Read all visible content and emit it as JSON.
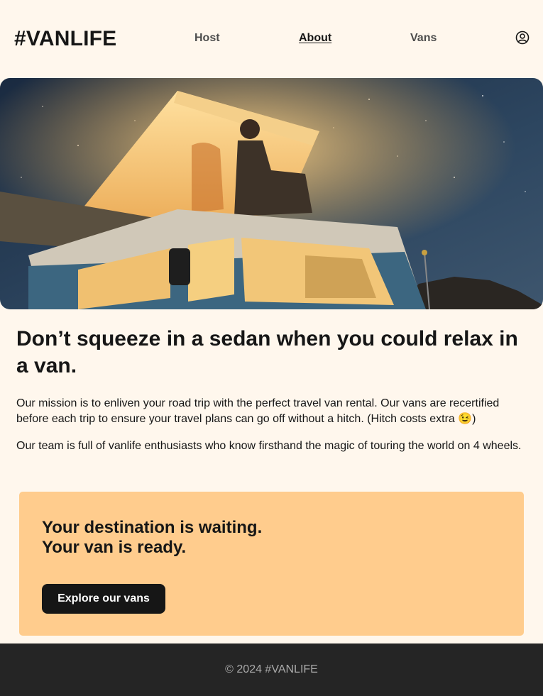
{
  "header": {
    "logo": "#VANLIFE",
    "nav": {
      "host": "Host",
      "about": "About",
      "vans": "Vans"
    },
    "user_icon": "user-circle-icon"
  },
  "hero": {
    "image_description": "camper van with illuminated pop-up roof at night, person sitting on roof under starry sky"
  },
  "about": {
    "title": "Don’t squeeze in a sedan when you could relax in a van.",
    "paragraph1": "Our mission is to enliven your road trip with the perfect travel van rental. Our vans are recertified before each trip to ensure your travel plans can go off without a hitch. (Hitch costs extra 😉)",
    "paragraph2": "Our team is full of vanlife enthusiasts who know firsthand the magic of touring the world on 4 wheels."
  },
  "cta": {
    "line1": "Your destination is waiting.",
    "line2": "Your van is ready.",
    "button": "Explore our vans"
  },
  "footer": {
    "copyright": "© 2024 #VANLIFE"
  },
  "colors": {
    "background": "#FFF7ED",
    "cta_background": "#FFCC8D",
    "dark": "#161616",
    "footer": "#252525"
  }
}
